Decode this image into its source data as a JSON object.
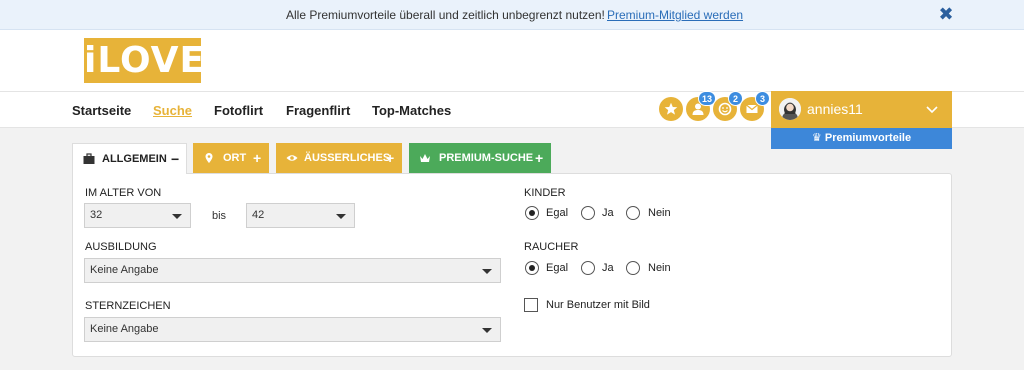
{
  "banner": {
    "text": "Alle Premiumvorteile überall und zeitlich unbegrenzt nutzen!",
    "link": "Premium-Mitglied werden",
    "close_icon": "close-icon"
  },
  "logo": {
    "text": "iLOVE"
  },
  "nav": {
    "items": [
      {
        "label": "Startseite",
        "active": false
      },
      {
        "label": "Suche",
        "active": true
      },
      {
        "label": "Fotoflirt",
        "active": false
      },
      {
        "label": "Fragenflirt",
        "active": false
      },
      {
        "label": "Top-Matches",
        "active": false
      }
    ]
  },
  "header_icons": [
    {
      "icon": "star-icon",
      "badge": ""
    },
    {
      "icon": "visitors-icon",
      "badge": "13"
    },
    {
      "icon": "likes-icon",
      "badge": "2"
    },
    {
      "icon": "messages-icon",
      "badge": "3"
    }
  ],
  "user": {
    "name": "annies11",
    "premium_label": "Premiumvorteile"
  },
  "tabs": [
    {
      "label": "ALLGEMEIN",
      "sign": "−",
      "icon": "briefcase-icon"
    },
    {
      "label": "ORT",
      "sign": "+",
      "icon": "location-pin-icon"
    },
    {
      "label": "ÄUSSERLICHES",
      "sign": "+",
      "icon": "eye-icon"
    },
    {
      "label": "PREMIUM-SUCHE",
      "sign": "+",
      "icon": "crown-icon"
    }
  ],
  "form": {
    "age_label": "IM ALTER VON",
    "age_from": "32",
    "age_sep": "bis",
    "age_to": "42",
    "education_label": "AUSBILDUNG",
    "education_value": "Keine Angabe",
    "zodiac_label": "STERNZEICHEN",
    "zodiac_value": "Keine Angabe",
    "children_label": "KINDER",
    "children_options": [
      "Egal",
      "Ja",
      "Nein"
    ],
    "children_selected": "Egal",
    "smoker_label": "RAUCHER",
    "smoker_options": [
      "Egal",
      "Ja",
      "Nein"
    ],
    "smoker_selected": "Egal",
    "photo_checkbox_label": "Nur Benutzer mit Bild",
    "photo_checked": false
  },
  "colors": {
    "accent": "#e7b339",
    "blue": "#3d87d9",
    "green": "#4caa5a"
  }
}
